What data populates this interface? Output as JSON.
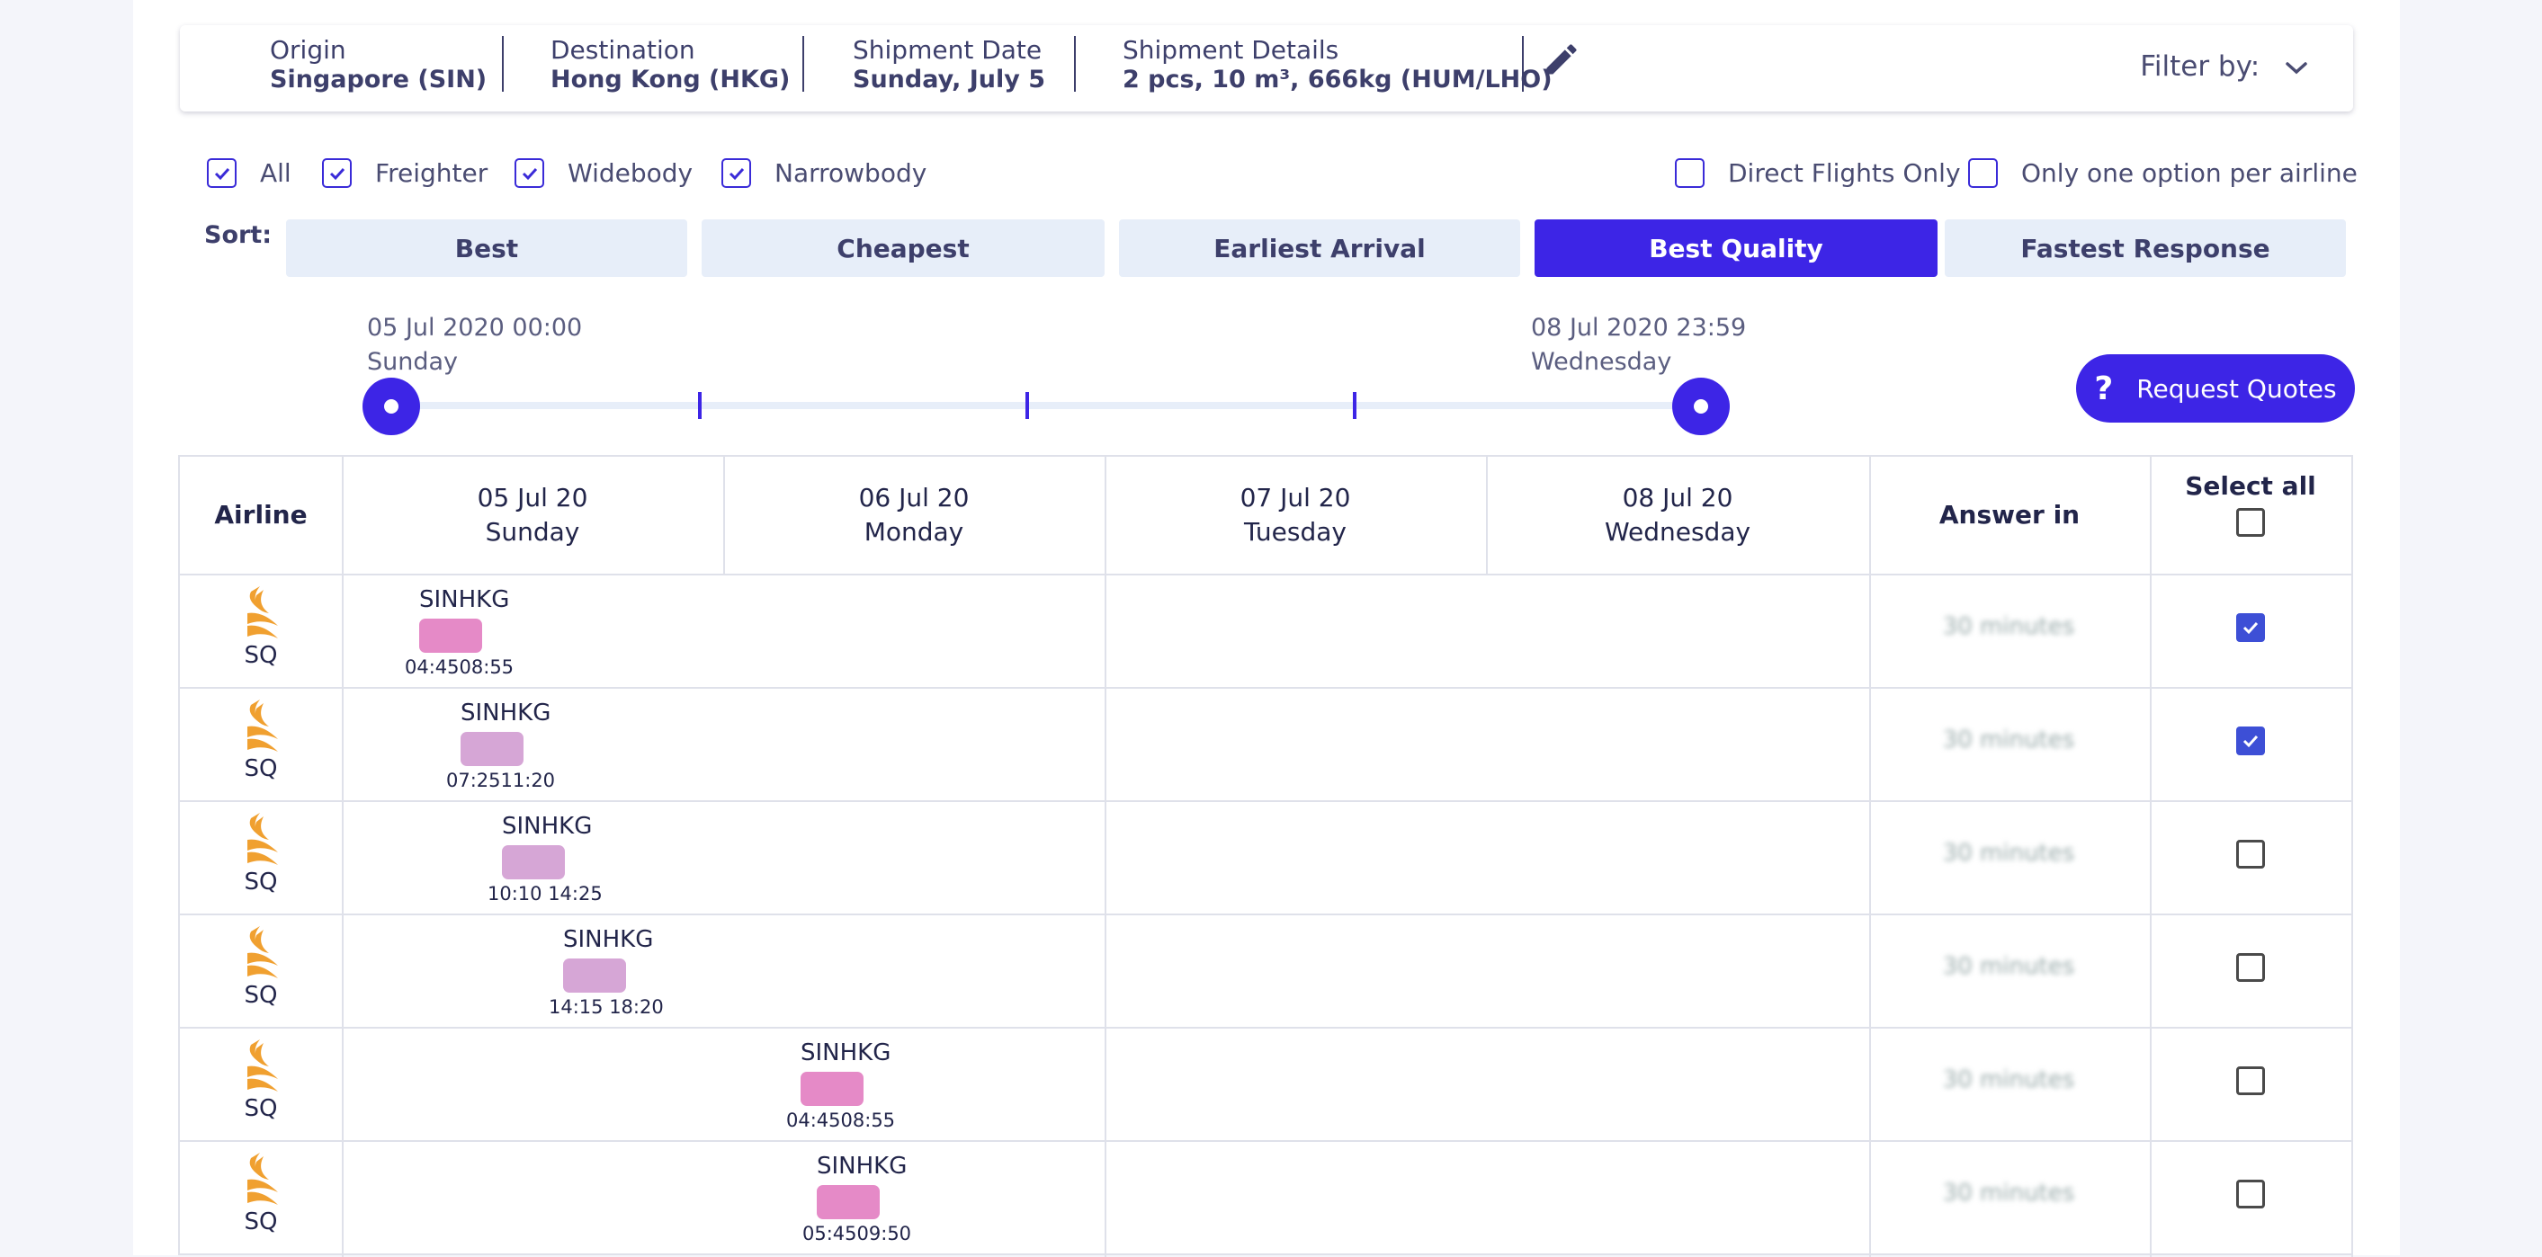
{
  "header": {
    "origin": {
      "label": "Origin",
      "value": "Singapore (SIN)"
    },
    "destination": {
      "label": "Destination",
      "value": "Hong Kong (HKG)"
    },
    "shipment_date": {
      "label": "Shipment Date",
      "value": "Sunday, July 5"
    },
    "shipment_details": {
      "label": "Shipment Details",
      "value": "2 pcs, 10 m³, 666kg (HUM/LHO)"
    },
    "filter_by": "Filter by:"
  },
  "filters": {
    "all": {
      "label": "All",
      "checked": true
    },
    "freighter": {
      "label": "Freighter",
      "checked": true
    },
    "widebody": {
      "label": "Widebody",
      "checked": true
    },
    "narrowbody": {
      "label": "Narrowbody",
      "checked": true
    },
    "direct_only": {
      "label": "Direct Flights Only",
      "checked": false
    },
    "one_per_airline": {
      "label": "Only one option per airline",
      "checked": false
    }
  },
  "sort": {
    "label": "Sort:",
    "options": [
      "Best",
      "Cheapest",
      "Earliest Arrival",
      "Best Quality",
      "Fastest Response"
    ],
    "active": "Best Quality"
  },
  "slider": {
    "start_date": "05 Jul 2020 00:00",
    "start_day": "Sunday",
    "end_date": "08 Jul 2020 23:59",
    "end_day": "Wednesday"
  },
  "request_quotes": {
    "icon": "?",
    "label": "Request Quotes"
  },
  "table": {
    "airline_header": "Airline",
    "days": [
      {
        "date": "05 Jul 20",
        "day": "Sunday"
      },
      {
        "date": "06 Jul 20",
        "day": "Monday"
      },
      {
        "date": "07 Jul 20",
        "day": "Tuesday"
      },
      {
        "date": "08 Jul 20",
        "day": "Wednesday"
      }
    ],
    "answer_header": "Answer in",
    "select_all": "Select all",
    "rows": [
      {
        "airline": "SQ",
        "route": "SINHKG",
        "times": "04:4508:55",
        "bar_color": "#e58ac7",
        "answer": "30 minutes",
        "selected": true
      },
      {
        "airline": "SQ",
        "route": "SINHKG",
        "times": "07:2511:20",
        "bar_color": "#d6a6d6",
        "answer": "30 minutes",
        "selected": true
      },
      {
        "airline": "SQ",
        "route": "SINHKG",
        "times": "10:10  14:25",
        "bar_color": "#d6a6d6",
        "answer": "30 minutes",
        "selected": false
      },
      {
        "airline": "SQ",
        "route": "SINHKG",
        "times": "14:15  18:20",
        "bar_color": "#d6a6d6",
        "answer": "30 minutes",
        "selected": false
      },
      {
        "airline": "SQ",
        "route": "SINHKG",
        "times": "04:4508:55",
        "bar_color": "#e58ac7",
        "answer": "30 minutes",
        "selected": false
      },
      {
        "airline": "SQ",
        "route": "SINHKG",
        "times": "05:4509:50",
        "bar_color": "#e58ac7",
        "answer": "30 minutes",
        "selected": false
      }
    ]
  },
  "colors": {
    "accent": "#3d25e6",
    "checkbox_checked": "#3d4fd6",
    "airline_logo": "#f0a030"
  }
}
